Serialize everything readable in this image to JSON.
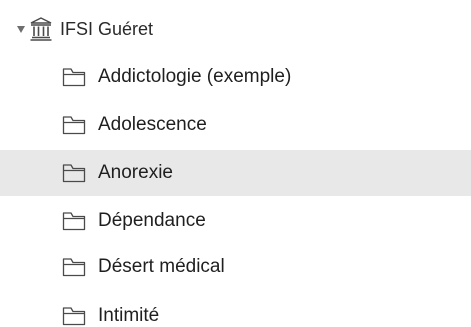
{
  "library": {
    "name": "IFSI Guéret",
    "expand_icon": "triangle-down-icon",
    "icon": "library-building-icon"
  },
  "collections": [
    {
      "label": "Addictologie (exemple)",
      "icon": "folder-icon",
      "selected": false
    },
    {
      "label": "Adolescence",
      "icon": "folder-icon",
      "selected": false
    },
    {
      "label": "Anorexie",
      "icon": "folder-icon",
      "selected": true
    },
    {
      "label": "Dépendance",
      "icon": "folder-icon",
      "selected": false
    },
    {
      "label": "Désert médical",
      "icon": "folder-icon",
      "selected": false
    },
    {
      "label": "Intimité",
      "icon": "folder-icon",
      "selected": false
    }
  ],
  "colors": {
    "selected_row": "#e8e8e8",
    "icon_stroke": "#4a4a4a",
    "text": "#1f1f1f"
  }
}
